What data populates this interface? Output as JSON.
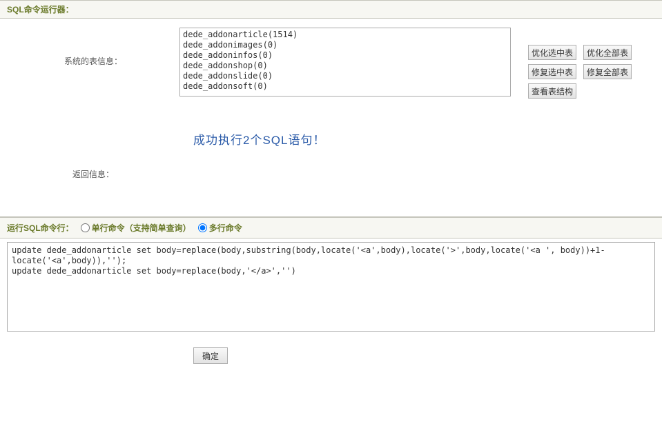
{
  "header": {
    "title": "SQL命令运行器："
  },
  "tableInfo": {
    "label": "系统的表信息：",
    "items": [
      "dede_addonarticle(1514)",
      "dede_addonimages(0)",
      "dede_addoninfos(0)",
      "dede_addonshop(0)",
      "dede_addonslide(0)",
      "dede_addonsoft(0)"
    ]
  },
  "buttons": {
    "optimize_selected": "优化选中表",
    "optimize_all": "优化全部表",
    "repair_selected": "修复选中表",
    "repair_all": "修复全部表",
    "view_structure": "查看表结构"
  },
  "returnInfo": {
    "label": "返回信息：",
    "message": "成功执行2个SQL语句！"
  },
  "cmdLine": {
    "title": "运行SQL命令行：",
    "single_label": "单行命令（支持简单查询）",
    "multi_label": "多行命令",
    "mode": "multi"
  },
  "sql": {
    "content": "update dede_addonarticle set body=replace(body,substring(body,locate('<a',body),locate('>',body,locate('<a ', body))+1-locate('<a',body)),'');\nupdate dede_addonarticle set body=replace(body,'</a>','')"
  },
  "footer": {
    "submit": "确定"
  }
}
